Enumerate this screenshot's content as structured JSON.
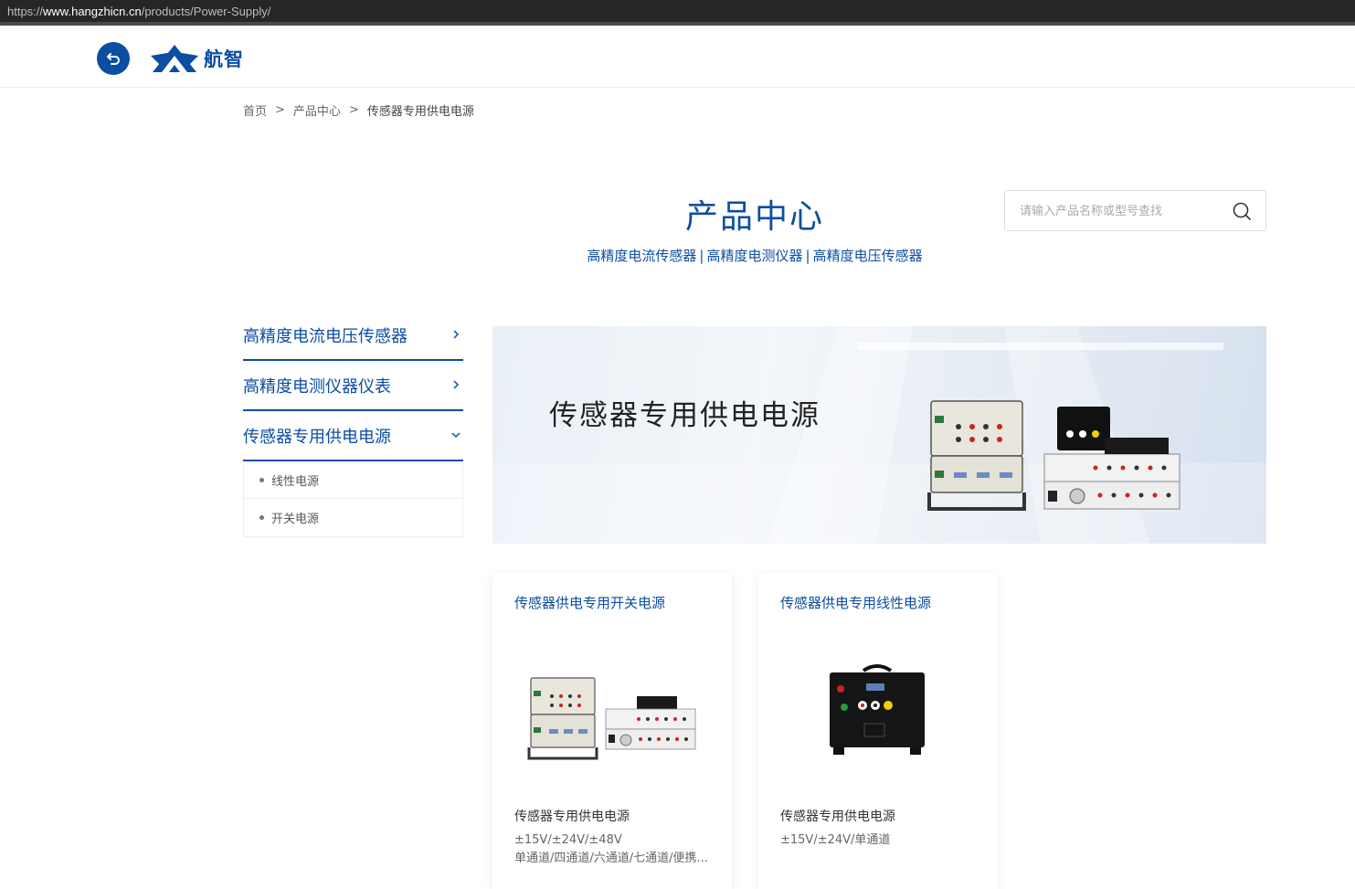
{
  "browser": {
    "url_scheme": "https://",
    "url_host": "www.hangzhicn.cn",
    "url_path": "/products/Power-Supply/"
  },
  "header": {
    "logo_text": "航智",
    "back_icon": "back-arrow-icon"
  },
  "breadcrumb": {
    "home": "首页",
    "separator": ">",
    "level1": "产品中心",
    "current": "传感器专用供电电源"
  },
  "page": {
    "title": "产品中心",
    "subcategories": [
      "高精度电流传感器",
      "高精度电测仪器",
      "高精度电压传感器"
    ],
    "subcategory_separator": "|"
  },
  "search": {
    "placeholder": "请输入产品名称或型号查找",
    "icon": "search-icon"
  },
  "sidebar": {
    "items": [
      {
        "label": "高精度电流电压传感器",
        "expanded": false
      },
      {
        "label": "高精度电测仪器仪表",
        "expanded": false
      },
      {
        "label": "传感器专用供电电源",
        "expanded": true
      }
    ],
    "subitems": [
      {
        "label": "线性电源"
      },
      {
        "label": "开关电源"
      }
    ]
  },
  "banner": {
    "title": "传感器专用供电电源"
  },
  "products": [
    {
      "title": "传感器供电专用开关电源",
      "name": "传感器专用供电电源",
      "desc_line1": "±15V/±24V/±48V",
      "desc_line2": "单通道/四通道/六通道/七通道/便携..."
    },
    {
      "title": "传感器供电专用线性电源",
      "name": "传感器专用供电电源",
      "desc_line1": "±15V/±24V/单通道",
      "desc_line2": ""
    }
  ],
  "colors": {
    "brand_blue": "#0b4ea2",
    "url_bar": "#262626"
  }
}
